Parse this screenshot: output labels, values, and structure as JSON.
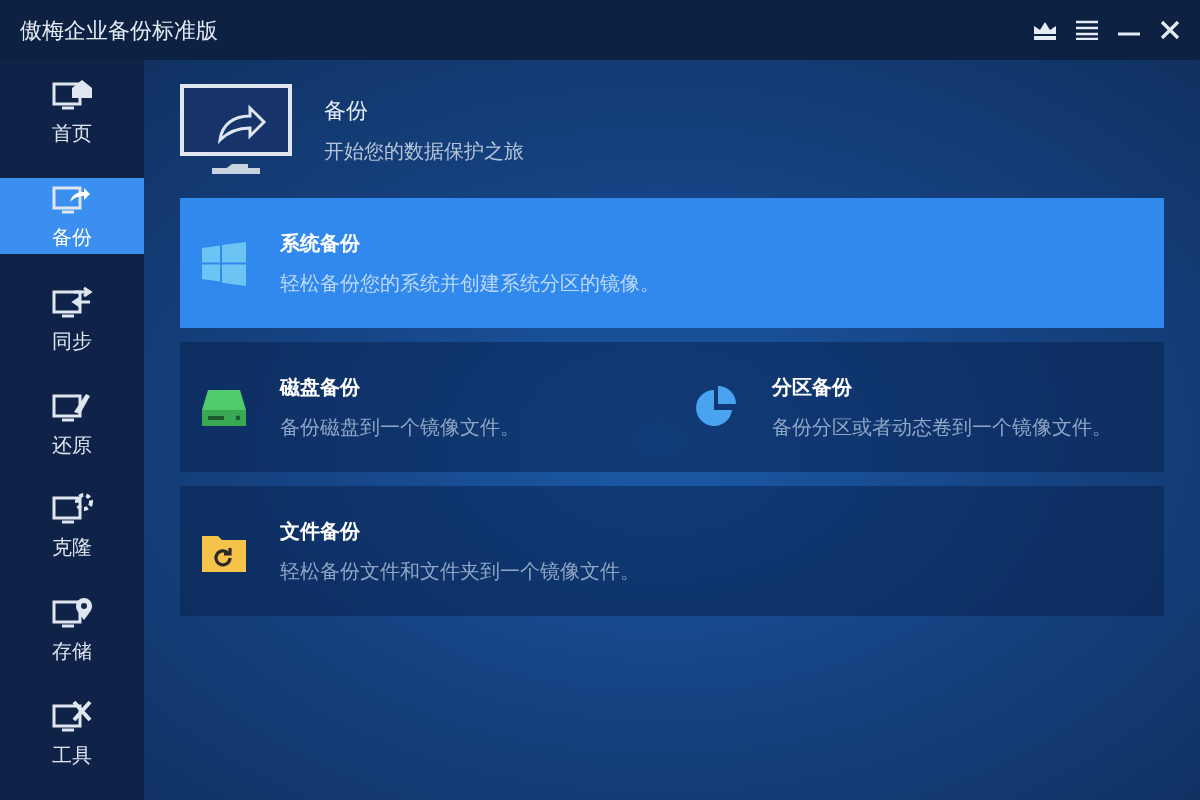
{
  "window": {
    "title": "傲梅企业备份标准版"
  },
  "sidebar": {
    "items": [
      {
        "label": "首页",
        "kind": "home",
        "selected": false
      },
      {
        "label": "备份",
        "kind": "backup",
        "selected": true
      },
      {
        "label": "同步",
        "kind": "sync",
        "selected": false
      },
      {
        "label": "还原",
        "kind": "restore",
        "selected": false
      },
      {
        "label": "克隆",
        "kind": "clone",
        "selected": false
      },
      {
        "label": "存储",
        "kind": "storage",
        "selected": false
      },
      {
        "label": "工具",
        "kind": "tools",
        "selected": false
      }
    ]
  },
  "header": {
    "title": "备份",
    "subtitle": "开始您的数据保护之旅"
  },
  "rows": [
    [
      {
        "kind": "system",
        "title": "系统备份",
        "description": "轻松备份您的系统并创建系统分区的镜像。",
        "selected": true
      }
    ],
    [
      {
        "kind": "disk",
        "title": "磁盘备份",
        "description": "备份磁盘到一个镜像文件。",
        "selected": false
      },
      {
        "kind": "partition",
        "title": "分区备份",
        "description": "备份分区或者动态卷到一个镜像文件。",
        "selected": false
      }
    ],
    [
      {
        "kind": "file",
        "title": "文件备份",
        "description": "轻松备份文件和文件夹到一个镜像文件。",
        "selected": false
      }
    ]
  ]
}
